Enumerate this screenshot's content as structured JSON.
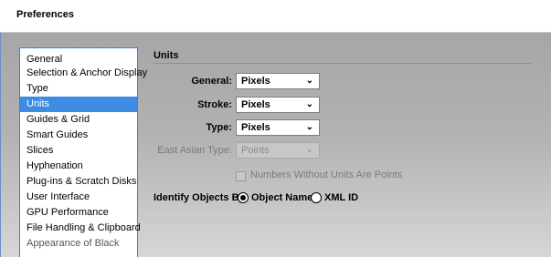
{
  "window": {
    "title": "Preferences"
  },
  "sidebar": {
    "items": [
      {
        "label": "General"
      },
      {
        "label": "Selection & Anchor Display"
      },
      {
        "label": "Type"
      },
      {
        "label": "Units",
        "selected": true
      },
      {
        "label": "Guides & Grid"
      },
      {
        "label": "Smart Guides"
      },
      {
        "label": "Slices"
      },
      {
        "label": "Hyphenation"
      },
      {
        "label": "Plug-ins & Scratch Disks"
      },
      {
        "label": "User Interface"
      },
      {
        "label": "GPU Performance"
      },
      {
        "label": "File Handling & Clipboard"
      },
      {
        "label": "Appearance of Black"
      }
    ]
  },
  "units": {
    "section_title": "Units",
    "general": {
      "label": "General:",
      "value": "Pixels"
    },
    "stroke": {
      "label": "Stroke:",
      "value": "Pixels"
    },
    "type": {
      "label": "Type:",
      "value": "Pixels"
    },
    "east_asian_type": {
      "label": "East Asian Type:",
      "value": "Points",
      "disabled": true
    },
    "numbers_without_units": {
      "label": "Numbers Without Units Are Points",
      "checked": false,
      "disabled": true
    },
    "identify_objects_by": {
      "label": "Identify Objects By:",
      "options": [
        {
          "label": "Object Name",
          "selected": true
        },
        {
          "label": "XML ID",
          "selected": false
        }
      ]
    }
  },
  "colors": {
    "selection": "#3d8ce4",
    "sidebar_border": "#3f7fd8"
  }
}
